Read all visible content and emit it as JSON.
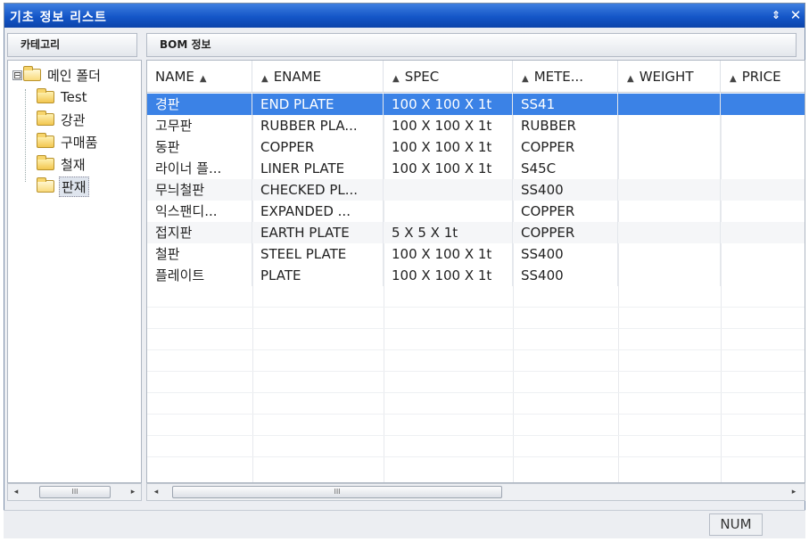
{
  "window": {
    "title": "기초 정보 리스트",
    "pin_icon": "⇕",
    "close_icon": "✕"
  },
  "left_panel": {
    "header": "카테고리"
  },
  "right_panel": {
    "header": "BOM 정보"
  },
  "tree": {
    "root": {
      "expander": "⊟",
      "label": "메인 폴더"
    },
    "children": [
      {
        "label": "Test"
      },
      {
        "label": "강관"
      },
      {
        "label": "구매품"
      },
      {
        "label": "철재"
      },
      {
        "label": "판재"
      }
    ],
    "selected_index": 4
  },
  "grid": {
    "columns": [
      {
        "label": "NAME",
        "sort_icon": "▲"
      },
      {
        "label": "ENAME",
        "sort_icon": "▲"
      },
      {
        "label": "SPEC",
        "sort_icon": "▲"
      },
      {
        "label": "METE...",
        "sort_icon": "▲"
      },
      {
        "label": "WEIGHT",
        "sort_icon": "▲"
      },
      {
        "label": "PRICE",
        "sort_icon": "▲"
      }
    ],
    "rows": [
      {
        "name": "경판",
        "ename": "END PLATE",
        "spec": "100 X 100 X 1t",
        "material": "SS41",
        "weight": "",
        "price": ""
      },
      {
        "name": "고무판",
        "ename": "RUBBER PLA...",
        "spec": "100 X 100 X 1t",
        "material": "RUBBER",
        "weight": "",
        "price": ""
      },
      {
        "name": "동판",
        "ename": "COPPER",
        "spec": "100 X 100 X 1t",
        "material": "COPPER",
        "weight": "",
        "price": ""
      },
      {
        "name": "라이너 플...",
        "ename": "LINER PLATE",
        "spec": "100 X 100 X 1t",
        "material": "S45C",
        "weight": "",
        "price": ""
      },
      {
        "name": "무늬철판",
        "ename": "CHECKED PL...",
        "spec": "",
        "material": "SS400",
        "weight": "",
        "price": ""
      },
      {
        "name": "익스팬디...",
        "ename": "EXPANDED ...",
        "spec": "",
        "material": "COPPER",
        "weight": "",
        "price": ""
      },
      {
        "name": "접지판",
        "ename": "EARTH PLATE",
        "spec": "5 X 5 X 1t",
        "material": "COPPER",
        "weight": "",
        "price": ""
      },
      {
        "name": "철판",
        "ename": "STEEL PLATE",
        "spec": "100 X 100 X 1t",
        "material": "SS400",
        "weight": "",
        "price": ""
      },
      {
        "name": "플레이트",
        "ename": "PLATE",
        "spec": "100 X 100 X 1t",
        "material": "SS400",
        "weight": "",
        "price": ""
      }
    ],
    "selected_row": 0
  },
  "scrollbars": {
    "left_arrow": "◂",
    "right_arrow": "▸",
    "thumb_grip": "III"
  },
  "status": {
    "num": "NUM"
  },
  "colors": {
    "titlebar": "#1456c8",
    "selection": "#3b82e6"
  }
}
